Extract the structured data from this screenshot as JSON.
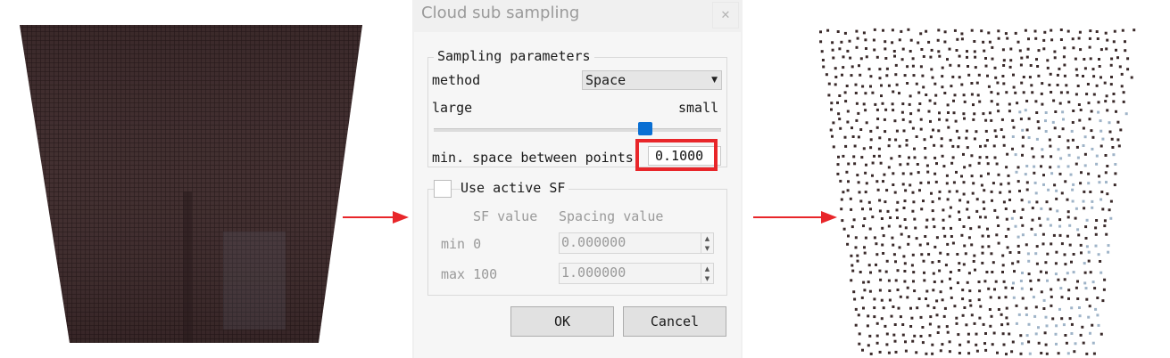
{
  "dialog": {
    "title": "Cloud sub sampling",
    "close_icon": "close-icon",
    "sampling_group_title": "Sampling parameters",
    "method_label": "method",
    "method_value": "Space",
    "slider_left_label": "large",
    "slider_right_label": "small",
    "min_space_label": "min. space between points",
    "min_space_value": "0.1000",
    "use_active_sf_label": "Use active SF",
    "sf_value_header": "SF value",
    "spacing_value_header": "Spacing value",
    "min_label": "min 0",
    "min_spacing_value": "0.000000",
    "max_label": "max 100",
    "max_spacing_value": "1.000000",
    "ok_label": "OK",
    "cancel_label": "Cancel"
  },
  "colors": {
    "highlight": "#e8262a",
    "arrow": "#e8262a",
    "slider_handle": "#0a6fd3",
    "dense_cloud": "#3f2c2d",
    "sparse_points": "#3a2a2a"
  },
  "icons": {
    "left_arrow": "right-arrow-icon",
    "right_arrow": "right-arrow-icon",
    "combo_arrow": "chevron-down-icon"
  }
}
